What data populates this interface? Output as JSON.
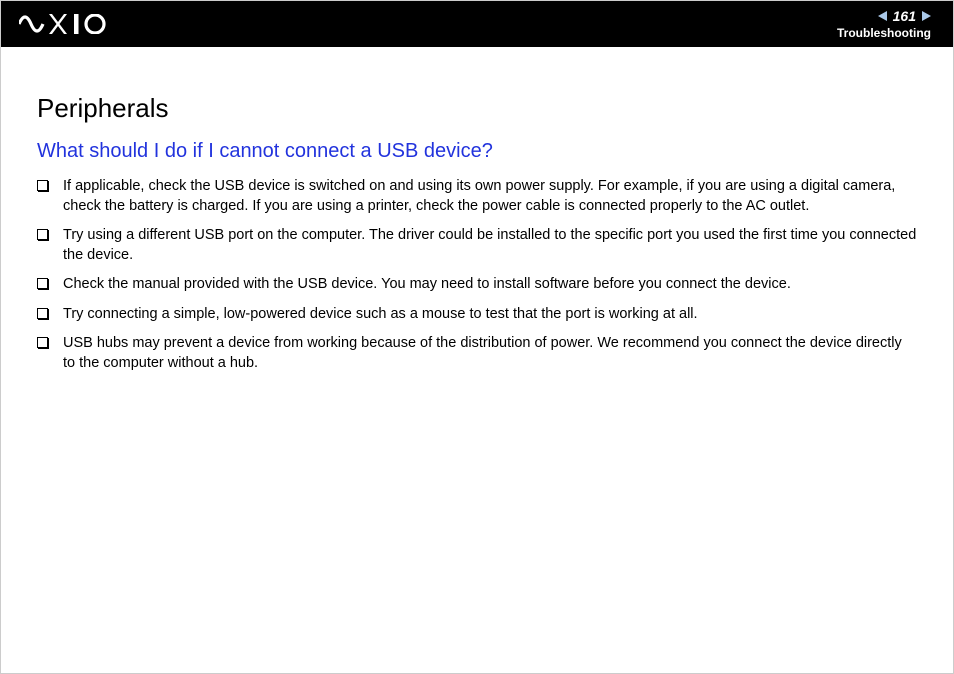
{
  "header": {
    "page_number": "161",
    "section": "Troubleshooting",
    "logo_alt": "VAIO"
  },
  "content": {
    "title": "Peripherals",
    "subheading": "What should I do if I cannot connect a USB device?",
    "items": [
      "If applicable, check the USB device is switched on and using its own power supply. For example, if you are using a digital camera, check the battery is charged. If you are using a printer, check the power cable is connected properly to the AC outlet.",
      "Try using a different USB port on the computer. The driver could be installed to the specific port you used the first time you connected the device.",
      "Check the manual provided with the USB device. You may need to install software before you connect the device.",
      "Try connecting a simple, low-powered device such as a mouse to test that the port is working at all.",
      "USB hubs may prevent a device from working because of the distribution of power. We recommend you connect the device directly to the computer without a hub."
    ]
  }
}
